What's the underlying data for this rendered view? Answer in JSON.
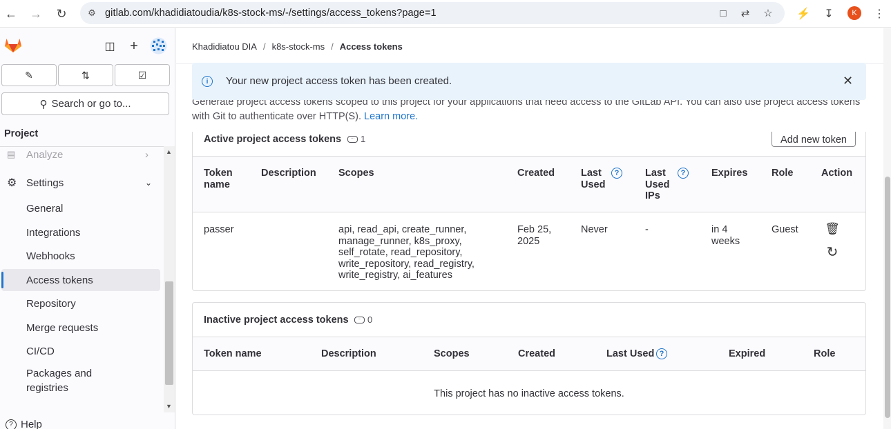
{
  "browser": {
    "url": "gitlab.com/khadidiatoudia/k8s-stock-ms/-/settings/access_tokens?page=1",
    "profile_initial": "K"
  },
  "sidebar": {
    "search_label": "Search or go to...",
    "section_title": "Project",
    "items": [
      {
        "label": "Analyze"
      },
      {
        "label": "Settings"
      },
      {
        "label": "General"
      },
      {
        "label": "Integrations"
      },
      {
        "label": "Webhooks"
      },
      {
        "label": "Access tokens"
      },
      {
        "label": "Repository"
      },
      {
        "label": "Merge requests"
      },
      {
        "label": "CI/CD"
      },
      {
        "label": "Packages and registries"
      }
    ],
    "help_label": "Help"
  },
  "breadcrumb": [
    "Khadidiatou DIA",
    "k8s-stock-ms",
    "Access tokens"
  ],
  "alert": {
    "message": "Your new project access token has been created."
  },
  "description": {
    "text": "Generate project access tokens scoped to this project for your applications that need access to the GitLab API. You can also use project access tokens with Git to authenticate over HTTP(S).",
    "link": "Learn more."
  },
  "active_tokens": {
    "title": "Active project access tokens",
    "count": "1",
    "add_button": "Add new token",
    "headers": {
      "token_name": "Token name",
      "description": "Description",
      "scopes": "Scopes",
      "created": "Created",
      "last_used": "Last Used",
      "last_used_ips": "Last Used IPs",
      "expires": "Expires",
      "role": "Role",
      "action": "Action"
    },
    "rows": [
      {
        "token_name": "passer",
        "description": "",
        "scopes": "api, read_api, create_runner, manage_runner, k8s_proxy, self_rotate, read_repository, write_repository, read_registry, write_registry, ai_features",
        "created": "Feb 25, 2025",
        "last_used": "Never",
        "last_used_ips": "-",
        "expires": "in 4 weeks",
        "role": "Guest"
      }
    ]
  },
  "inactive_tokens": {
    "title": "Inactive project access tokens",
    "count": "0",
    "headers": {
      "token_name": "Token name",
      "description": "Description",
      "scopes": "Scopes",
      "created": "Created",
      "last_used": "Last Used",
      "expired": "Expired",
      "role": "Role"
    },
    "empty_text": "This project has no inactive access tokens."
  }
}
